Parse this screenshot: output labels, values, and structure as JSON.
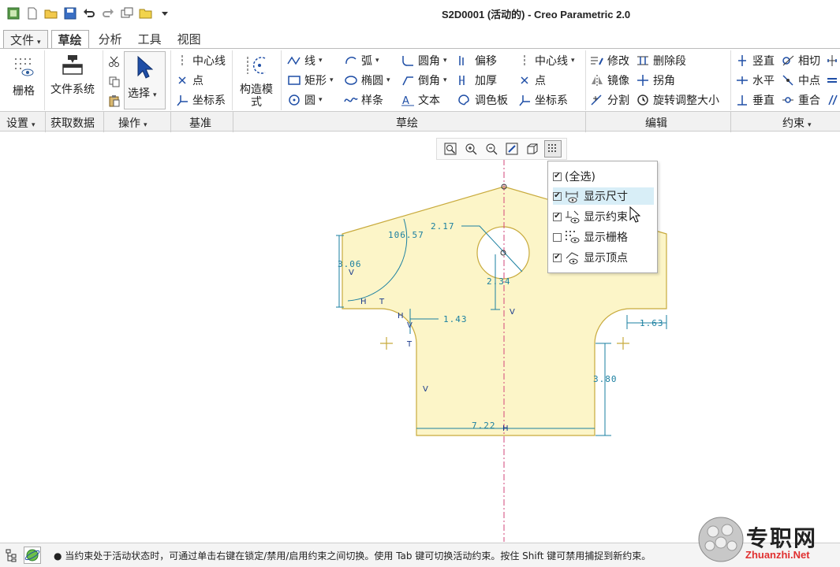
{
  "window": {
    "title": "S2D0001 (活动的) - Creo Parametric 2.0"
  },
  "quick_access": [
    "app-icon",
    "new-icon",
    "open-icon",
    "save-icon",
    "undo-icon",
    "redo-icon",
    "window-icon",
    "folder-icon",
    "customize-icon"
  ],
  "tabs": [
    {
      "label": "文件",
      "dropdown": "▾"
    },
    {
      "label": "草绘"
    },
    {
      "label": "分析"
    },
    {
      "label": "工具"
    },
    {
      "label": "视图"
    }
  ],
  "ribbon": {
    "grid": "栅格",
    "file_system": "文件系统",
    "cut": "剪切",
    "select": "选择",
    "datum": {
      "centerline": "中心线",
      "point": "点",
      "coord": "坐标系"
    },
    "construction": "构造模式",
    "sketch": {
      "line": "线",
      "rect": "矩形",
      "circle": "圆",
      "arc": "弧",
      "ellipse": "椭圆",
      "spline": "样条",
      "fillet": "圆角",
      "chamfer": "倒角",
      "text": "文本",
      "offset": "偏移",
      "thicken": "加厚",
      "palette": "调色板",
      "centerline": "中心线",
      "point": "点",
      "coord": "坐标系"
    },
    "edit": {
      "modify": "修改",
      "mirror": "镜像",
      "divide": "分割",
      "delete_segment": "删除段",
      "corner": "拐角",
      "rotate_resize": "旋转调整大小"
    },
    "constrain": {
      "vertical": "竖直",
      "horizontal": "水平",
      "perpendicular": "垂直",
      "tangent": "相切",
      "midpoint": "中点",
      "coincident": "重合"
    },
    "groups": {
      "settings": "设置",
      "get_data": "获取数据",
      "operations": "操作",
      "datum": "基准",
      "sketch": "草绘",
      "edit": "编辑",
      "constrain": "约束"
    }
  },
  "display_popup": {
    "items": [
      {
        "label": "(全选)",
        "checked": true,
        "check": "✔"
      },
      {
        "label": "显示尺寸",
        "checked": true,
        "check": "✔"
      },
      {
        "label": "显示约束",
        "checked": true,
        "check": "✔"
      },
      {
        "label": "显示栅格",
        "checked": false,
        "check": ""
      },
      {
        "label": "显示顶点",
        "checked": true,
        "check": "✔"
      }
    ]
  },
  "sketch": {
    "dims": {
      "d1": "106.57",
      "d2": "2.17",
      "d3": "3.06",
      "d4": "2.34",
      "d5": "1.43",
      "d6": "1.63",
      "d7": "3.80",
      "d8": "7.22"
    },
    "constraint_labels": {
      "v": "V",
      "h": "H",
      "t": "T"
    },
    "fill_color": "#fcf5c8",
    "dim_color": "#1a7fa0",
    "constraint_color": "#1a3a8c"
  },
  "status": {
    "message": "● 当约束处于活动状态时，可通过单击右键在锁定/禁用/启用约束之间切换。使用 Tab 键可切换活动约束。按住 Shift 键可禁用捕捉到新约束。"
  },
  "watermark": {
    "text": "专职网",
    "url": "Zhuanzhi.Net"
  }
}
